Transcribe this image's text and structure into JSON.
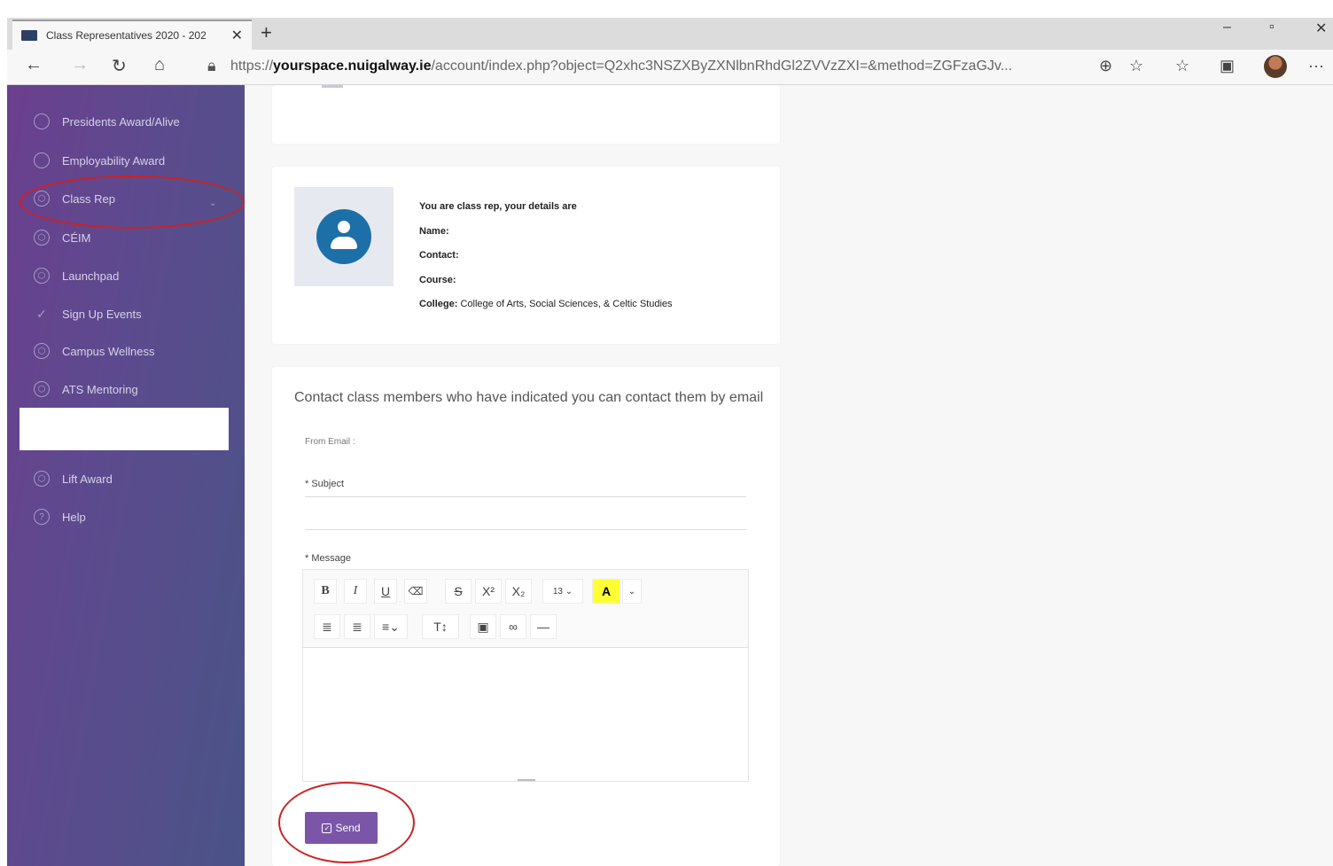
{
  "browser": {
    "tab_title": "Class Representatives 2020 - 202",
    "tab_close": "✕",
    "new_tab": "+",
    "url_prefix": "https://",
    "url_domain": "yourspace.nuigalway.ie",
    "url_rest": "/account/index.php?object=Q2xhc3NSZXByZXNlbnRhdGl2ZVVzZXI=&method=ZGFzaGJv...",
    "minimize": "–",
    "maximize": "▫",
    "close": "✕",
    "back": "←",
    "forward": "→",
    "refresh": "↻",
    "home": "⌂",
    "zoom_icon": "zoom-icon",
    "more": "···"
  },
  "sidebar": {
    "items": [
      {
        "label": "Presidents Award/Alive"
      },
      {
        "label": "Employability Award"
      },
      {
        "label": "Class Rep",
        "expandable": true
      },
      {
        "label": "CÉIM"
      },
      {
        "label": "Launchpad"
      },
      {
        "label": "Sign Up Events"
      },
      {
        "label": "Campus Wellness"
      },
      {
        "label": "ATS Mentoring"
      },
      {
        "label": "Lift Award"
      },
      {
        "label": "Help"
      }
    ]
  },
  "rep_details": {
    "intro": "You are class rep, your details are",
    "name_label": "Name:",
    "contact_label": "Contact:",
    "course_label": "Course:",
    "college_label": "College:",
    "college_value": "College of Arts, Social Sciences, & Celtic Studies"
  },
  "contact_form": {
    "title": "Contact class members who have indicated you can contact them by email",
    "from_label": "From Email :",
    "subject_label": "* Subject",
    "message_label": "* Message",
    "font_size": "13",
    "send_label": "Send"
  },
  "colors": {
    "sidebar_start": "#6b3f8f",
    "sidebar_end": "#4a5387",
    "send_button": "#7b56a8",
    "annotation": "#cc2222"
  }
}
